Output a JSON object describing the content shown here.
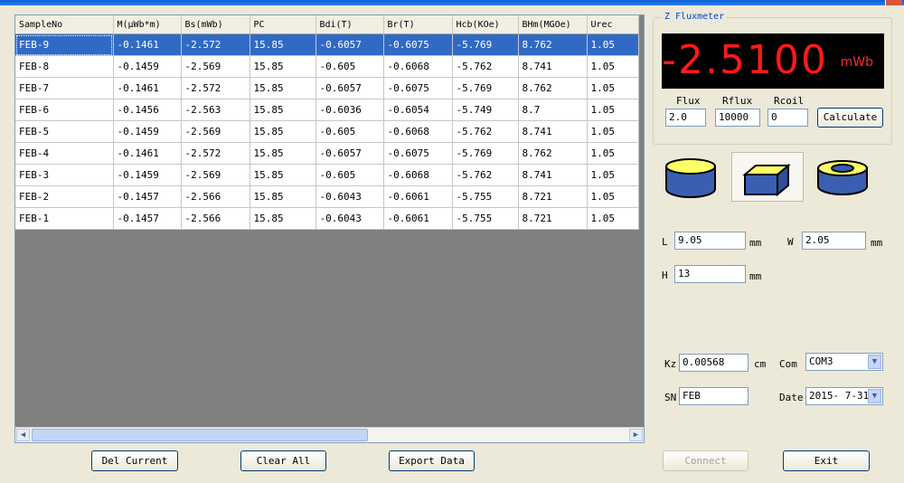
{
  "grid": {
    "columns": [
      "SampleNo",
      "M(μWb*m)",
      "Bs(mWb)",
      "PC",
      "Bdi(T)",
      "Br(T)",
      "Hcb(KOe)",
      "BHm(MGOe)",
      "Urec"
    ],
    "rows": [
      [
        "FEB-9",
        "-0.1461",
        "-2.572",
        "15.85",
        "-0.6057",
        "-0.6075",
        "-5.769",
        "8.762",
        "1.05"
      ],
      [
        "FEB-8",
        "-0.1459",
        "-2.569",
        "15.85",
        "-0.605",
        "-0.6068",
        "-5.762",
        "8.741",
        "1.05"
      ],
      [
        "FEB-7",
        "-0.1461",
        "-2.572",
        "15.85",
        "-0.6057",
        "-0.6075",
        "-5.769",
        "8.762",
        "1.05"
      ],
      [
        "FEB-6",
        "-0.1456",
        "-2.563",
        "15.85",
        "-0.6036",
        "-0.6054",
        "-5.749",
        "8.7",
        "1.05"
      ],
      [
        "FEB-5",
        "-0.1459",
        "-2.569",
        "15.85",
        "-0.605",
        "-0.6068",
        "-5.762",
        "8.741",
        "1.05"
      ],
      [
        "FEB-4",
        "-0.1461",
        "-2.572",
        "15.85",
        "-0.6057",
        "-0.6075",
        "-5.769",
        "8.762",
        "1.05"
      ],
      [
        "FEB-3",
        "-0.1459",
        "-2.569",
        "15.85",
        "-0.605",
        "-0.6068",
        "-5.762",
        "8.741",
        "1.05"
      ],
      [
        "FEB-2",
        "-0.1457",
        "-2.566",
        "15.85",
        "-0.6043",
        "-0.6061",
        "-5.755",
        "8.721",
        "1.05"
      ],
      [
        "FEB-1",
        "-0.1457",
        "-2.566",
        "15.85",
        "-0.6043",
        "-0.6061",
        "-5.755",
        "8.721",
        "1.05"
      ]
    ],
    "selected_row": 0
  },
  "buttons": {
    "del_current": "Del Current",
    "clear_all": "Clear All",
    "export_data": "Export Data",
    "connect": "Connect",
    "exit": "Exit",
    "calculate": "Calculate"
  },
  "fluxmeter": {
    "title": "Z Fluxmeter",
    "reading": "-2.5100",
    "unit": "mWb",
    "flux_label": "Flux",
    "flux_value": "2.0",
    "rflux_label": "Rflux",
    "rflux_value": "10000",
    "rcoil_label": "Rcoil",
    "rcoil_value": "0"
  },
  "dimensions": {
    "l_label": "L",
    "l_value": "9.05",
    "l_unit": "mm",
    "w_label": "W",
    "w_value": "2.05",
    "w_unit": "mm",
    "h_label": "H",
    "h_value": "13",
    "h_unit": "mm"
  },
  "settings": {
    "kz_label": "Kz",
    "kz_value": "0.00568",
    "kz_unit": "cm",
    "com_label": "Com",
    "com_value": "COM3",
    "sn_label": "SN",
    "sn_value": "FEB",
    "date_label": "Date",
    "date_value": "2015- 7-31"
  },
  "icons": {
    "shape_cylinder": "cylinder-icon",
    "shape_block": "block-icon",
    "shape_ring": "ring-icon"
  },
  "colors": {
    "display_bg": "#000000",
    "display_text": "#ff1a1a",
    "selection": "#316ac5",
    "shape_yellow": "#ffff66",
    "shape_blue": "#3a5fb0"
  }
}
